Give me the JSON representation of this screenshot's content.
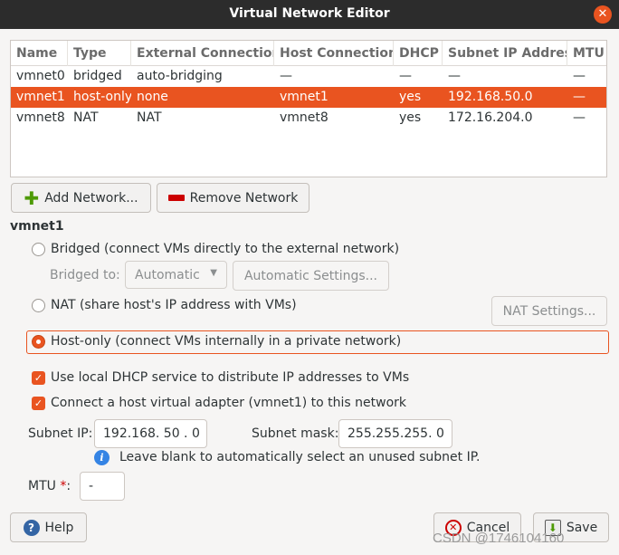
{
  "window": {
    "title": "Virtual Network Editor",
    "close_glyph": "✕"
  },
  "table": {
    "headers": [
      "Name",
      "Type",
      "External Connection",
      "Host Connection",
      "DHCP",
      "Subnet IP Address",
      "MTU"
    ],
    "rows": [
      {
        "name": "vmnet0",
        "type": "bridged",
        "external": "auto-bridging",
        "host": "—",
        "dhcp": "—",
        "subnet": "—",
        "mtu": "—",
        "selected": false
      },
      {
        "name": "vmnet1",
        "type": "host-only",
        "external": "none",
        "host": "vmnet1",
        "dhcp": "yes",
        "subnet": "192.168.50.0",
        "mtu": "—",
        "selected": true
      },
      {
        "name": "vmnet8",
        "type": "NAT",
        "external": "NAT",
        "host": "vmnet8",
        "dhcp": "yes",
        "subnet": "172.16.204.0",
        "mtu": "—",
        "selected": false
      }
    ]
  },
  "toolbar": {
    "add_label": "Add Network...",
    "remove_label": "Remove Network"
  },
  "selected_network": {
    "label": "vmnet1"
  },
  "modes": {
    "bridged_label": "Bridged (connect VMs directly to the external network)",
    "bridged_to_label": "Bridged to:",
    "bridged_to_value": "Automatic",
    "auto_settings_label": "Automatic Settings...",
    "nat_label": "NAT (share host's IP address with VMs)",
    "nat_settings_label": "NAT Settings...",
    "hostonly_label": "Host-only (connect VMs internally in a private network)",
    "selected": "host-only"
  },
  "options": {
    "dhcp_label": "Use local DHCP service to distribute IP addresses to VMs",
    "dhcp_checked": true,
    "adapter_label": "Connect a host virtual adapter (vmnet1) to this network",
    "adapter_checked": true
  },
  "subnet": {
    "ip_label": "Subnet IP:",
    "ip_value": "192.168. 50 .  0",
    "mask_label": "Subnet mask:",
    "mask_value": "255.255.255.  0",
    "hint": "Leave blank to automatically select an unused subnet IP."
  },
  "mtu": {
    "label": "MTU",
    "required_mark": "*",
    "colon": ":",
    "value": "-"
  },
  "footer": {
    "help_label": "Help",
    "cancel_label": "Cancel",
    "save_label": "Save"
  },
  "watermark": "CSDN @1746104160",
  "colors": {
    "accent": "#e95420",
    "titlebar": "#2c2c2c",
    "background": "#f6f5f4"
  },
  "icons": {
    "add": "plus-icon",
    "remove": "minus-icon",
    "help": "help-icon",
    "cancel": "cancel-icon",
    "save": "save-icon",
    "info": "info-icon",
    "close": "close-icon"
  }
}
